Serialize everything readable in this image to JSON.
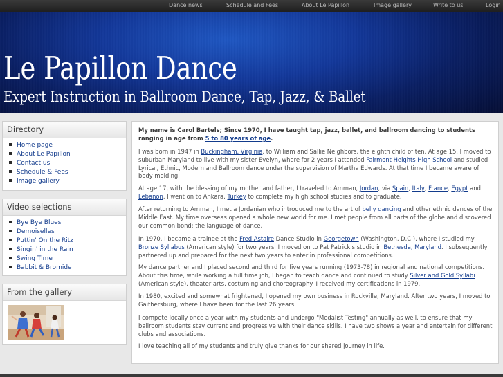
{
  "nav": {
    "items": [
      "Dance news",
      "Schedule and Fees",
      "About Le Papillon",
      "Image gallery",
      "Write to us",
      "Login"
    ]
  },
  "banner": {
    "title": "Le Papillon Dance",
    "subtitle": "Expert Instruction in Ballroom Dance, Tap, Jazz, & Ballet"
  },
  "directory": {
    "heading": "Directory",
    "items": [
      "Home page",
      "About Le Papillon",
      "Contact us",
      "Schedule & Fees",
      "Image gallery"
    ]
  },
  "videos": {
    "heading": "Video selections",
    "items": [
      "Bye Bye Blues",
      "Demoiselles",
      "Puttin' On the Ritz",
      "Singin' in the Rain",
      "Swing Time",
      "Babbit & Bromide"
    ]
  },
  "gallery": {
    "heading": "From the gallery"
  },
  "content": {
    "p1": {
      "a": "My name is Carol Bartels; Since 1970, I have taught tap, jazz, ballet, and ballroom dancing to students ranging in age from ",
      "link": "5 to 80 years of age",
      "b": "."
    },
    "p2": {
      "a": "I was born in 1947 in ",
      "l1": "Buckingham, Virginia",
      "b": ", to William and Sallie Neighbors, the eighth child of ten. At age 15, I moved to suburban Maryland to live with my sister Evelyn, where for 2 years I attended ",
      "l2": "Fairmont Heights High School",
      "c": " and studied Lyrical, Ethnic, Modern and Ballroom dance under the supervision of Martha Edwards. At that time I became aware of body molding."
    },
    "p3": {
      "a": "At age 17, with the blessing of my mother and father, I traveled to Amman, ",
      "l1": "Jordan",
      "b": ", via ",
      "l2": "Spain",
      "c": ", ",
      "l3": "Italy",
      "d": ", ",
      "l4": "France",
      "e": ", ",
      "l5": "Egypt",
      "f": " and ",
      "l6": "Lebanon",
      "g": ". I went on to Ankara, ",
      "l7": "Turkey",
      "h": " to complete my high school studies and to graduate."
    },
    "p4": {
      "a": "After returning to Amman, I met a Jordanian who introduced me to the art of ",
      "l1": "belly dancing",
      "b": " and other ethnic dances of the Middle East. My time overseas opened a whole new world for me. I met people from all parts of the globe and discovered our common bond: the language of dance."
    },
    "p5": {
      "a": "In 1970, I became a trainee at the ",
      "l1": "Fred Astaire",
      "b": " Dance Studio in ",
      "l2": "Georgetown",
      "c": " (Washington, D.C.), where I studied my ",
      "l3": "Bronze Syllabus",
      "d": " (American style) for two years. I moved on to Pat Patrick's studio in ",
      "l4": "Bethesda, Maryland",
      "e": ". I subsequently partnered up and prepared for the next two years to enter in professional competitions."
    },
    "p6": {
      "a": "My dance partner and I placed second and third for five years running (1973-78) in regional and national competitions. About this time, while working a full time job, I began to teach dance and continued to study ",
      "l1": "Silver and Gold Syllabi",
      "b": " (American style), theater arts, costuming and choreography. I received my certifications in 1979."
    },
    "p7": "In 1980, excited and somewhat frightened, I opened my own business in Rockville, Maryland. After two years, I moved to Gaithersburg, where I have been for the last 26 years.",
    "p8": "I compete locally once a year with my students and undergo \"Medalist Testing\" annually as well, to ensure that my ballroom students stay current and progressive with their dance skills. I have two shows a year and entertain for different clubs and associations.",
    "p9": "I love teaching all of my students and truly give thanks for our shared journey in life."
  }
}
